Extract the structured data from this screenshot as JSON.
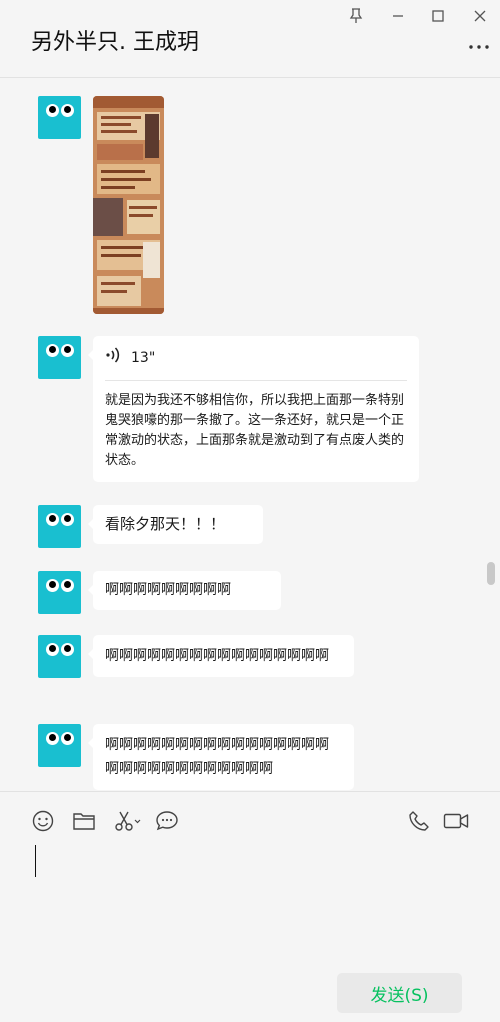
{
  "window": {
    "title": "另外半只. 王成玥"
  },
  "messages": [
    {
      "type": "image"
    },
    {
      "type": "voice",
      "duration": "13\"",
      "transcript": "就是因为我还不够相信你，所以我把上面那一条特别鬼哭狼嚎的那一条撤了。这一条还好，就只是一个正常激动的状态，上面那条就是激动到了有点废人类的状态。"
    },
    {
      "type": "text",
      "text": "看除夕那天！！！"
    },
    {
      "type": "text",
      "text": "啊啊啊啊啊啊啊啊啊"
    },
    {
      "type": "text",
      "text": "啊啊啊啊啊啊啊啊啊啊啊啊啊啊啊啊"
    },
    {
      "type": "text",
      "text": "啊啊啊啊啊啊啊啊啊啊啊啊啊啊啊啊啊啊啊啊啊啊啊啊啊啊啊啊"
    }
  ],
  "composer": {
    "send_label": "发送(S)"
  },
  "colors": {
    "avatar": "#19bfd0",
    "send_text": "#07c160",
    "background": "#f5f5f5"
  },
  "icons": [
    "pin-icon",
    "minimize-icon",
    "maximize-icon",
    "close-icon",
    "more-icon",
    "emoji-icon",
    "folder-icon",
    "scissors-icon",
    "chat-bubble-icon",
    "phone-icon",
    "video-icon",
    "voice-wave-icon"
  ]
}
